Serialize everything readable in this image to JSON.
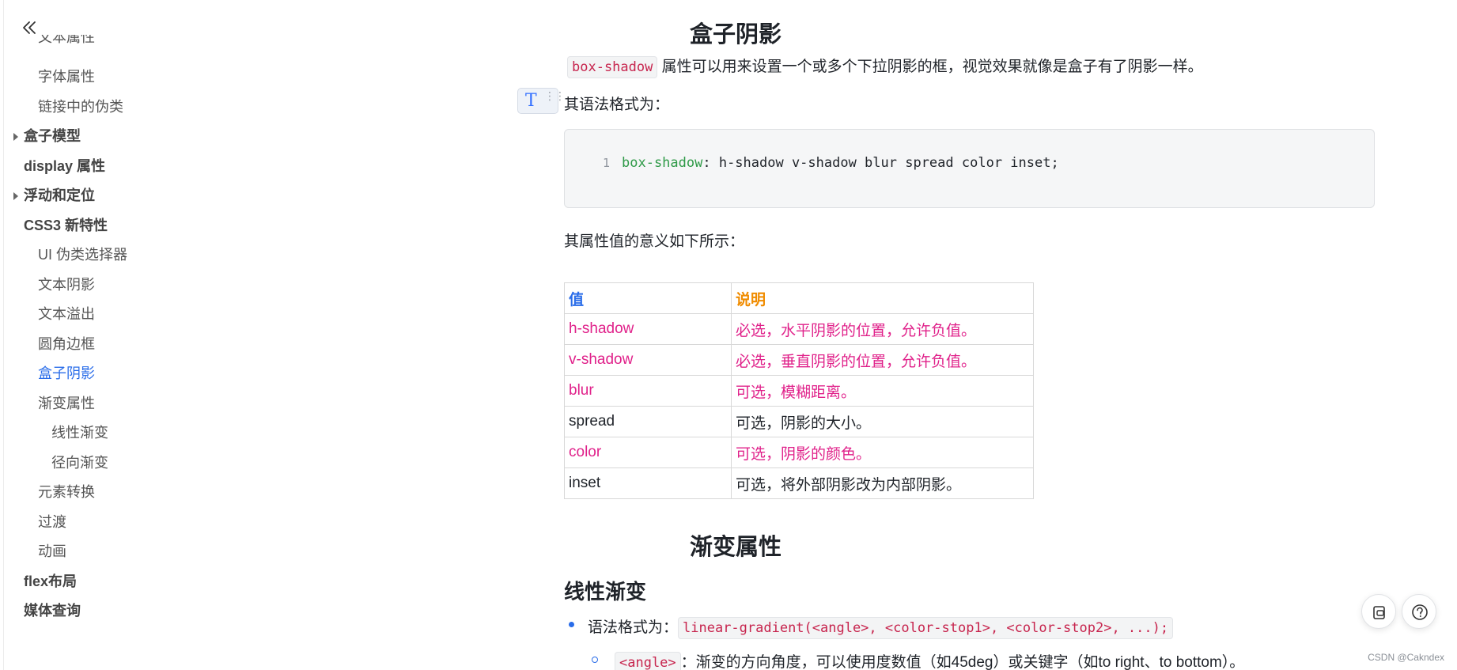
{
  "sidebar": {
    "items": [
      {
        "label": "文本属性",
        "level": 2
      },
      {
        "label": "字体属性",
        "level": 2
      },
      {
        "label": "链接中的伪类",
        "level": 2
      },
      {
        "label": "盒子模型",
        "level": 1,
        "collapsed": true
      },
      {
        "label": "display 属性",
        "level": 1
      },
      {
        "label": "浮动和定位",
        "level": 1,
        "collapsed": true
      },
      {
        "label": "CSS3 新特性",
        "level": 1
      },
      {
        "label": "UI 伪类选择器",
        "level": 2
      },
      {
        "label": "文本阴影",
        "level": 2
      },
      {
        "label": "文本溢出",
        "level": 2
      },
      {
        "label": "圆角边框",
        "level": 2
      },
      {
        "label": "盒子阴影",
        "level": 2,
        "active": true
      },
      {
        "label": "渐变属性",
        "level": 2
      },
      {
        "label": "线性渐变",
        "level": 3
      },
      {
        "label": "径向渐变",
        "level": 3
      },
      {
        "label": "元素转换",
        "level": 2
      },
      {
        "label": "过渡",
        "level": 2
      },
      {
        "label": "动画",
        "level": 2
      },
      {
        "label": "flex布局",
        "level": 1
      },
      {
        "label": "媒体查询",
        "level": 1
      }
    ]
  },
  "doc": {
    "title_box_shadow": "盒子阴影",
    "intro_code": "box-shadow",
    "intro_text": " 属性可以用来设置一个或多个下拉阴影的框，视觉效果就像是盒子有了阴影一样。",
    "syntax_label": "其语法格式为：",
    "code_line_number": "1",
    "code_prop": "box-shadow",
    "code_rest": ": h-shadow v-shadow blur spread color inset;",
    "meaning_label": "其属性值的意义如下所示：",
    "table": {
      "headers": [
        "值",
        "说明"
      ],
      "rows": [
        {
          "value": "h-shadow",
          "desc": "必选，水平阴影的位置，允许负值。",
          "color": "#e0218a"
        },
        {
          "value": "v-shadow",
          "desc": "必选，垂直阴影的位置，允许负值。",
          "color": "#e0218a"
        },
        {
          "value": "blur",
          "desc": "可选，模糊距离。",
          "color": "#e0218a"
        },
        {
          "value": "spread",
          "desc": "可选，阴影的大小。",
          "color": "#1f2329"
        },
        {
          "value": "color",
          "desc": "可选，阴影的颜色。",
          "color": "#e0218a"
        },
        {
          "value": "inset",
          "desc": "可选，将外部阴影改为内部阴影。",
          "color": "#1f2329"
        }
      ]
    },
    "title_gradient": "渐变属性",
    "h2_linear": "线性渐变",
    "syntax_item_label": "语法格式为：",
    "syntax_item_code": "linear-gradient(<angle>, <color-stop1>, <color-stop2>, ...);",
    "angle_code": "<angle>",
    "angle_text": "：渐变的方向角度，可以使用度数值（如45deg）或关键字（如to right、to bottom）。"
  },
  "colors": {
    "accent": "#2a6de9",
    "header_value": "#2a6de9",
    "header_desc": "#f08c00",
    "highlight": "#e0218a"
  },
  "watermark": "CSDN @Cakndex"
}
